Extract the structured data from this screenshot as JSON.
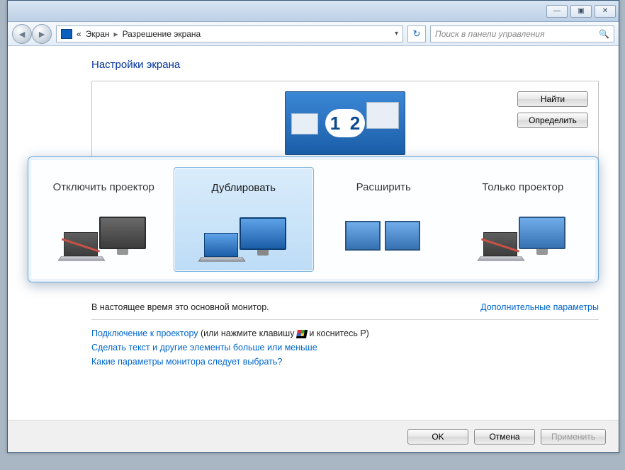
{
  "titlebar": {
    "min_glyph": "—",
    "max_glyph": "▣",
    "close_glyph": "✕"
  },
  "toolbar": {
    "back_glyph": "◄",
    "fwd_glyph": "►",
    "chevrons": "«",
    "crumb1": "Экран",
    "sep": "▸",
    "crumb2": "Разрешение экрана",
    "dropdown_glyph": "▾",
    "refresh_glyph": "↻",
    "search_placeholder": "Поиск в панели управления",
    "search_icon": "🔍"
  },
  "page": {
    "title": "Настройки экрана",
    "find_btn": "Найти",
    "identify_btn": "Определить",
    "mon1": "1",
    "mon2": "2"
  },
  "projection": {
    "opts": [
      {
        "label": "Отключить проектор"
      },
      {
        "label": "Дублировать"
      },
      {
        "label": "Расширить"
      },
      {
        "label": "Только проектор"
      }
    ],
    "selected_index": 1
  },
  "below": {
    "main_monitor_note": "В настоящее время это основной монитор.",
    "advanced_link": "Дополнительные параметры",
    "projector_link": "Подключение к проектору",
    "projector_hint_pre": " (или нажмите клавишу ",
    "projector_hint_post": " и коснитесь P)",
    "text_size_link": "Сделать текст и другие элементы больше или меньше",
    "which_settings_link": "Какие параметры монитора следует выбрать?"
  },
  "footer": {
    "ok": "OK",
    "cancel": "Отмена",
    "apply": "Применить"
  }
}
